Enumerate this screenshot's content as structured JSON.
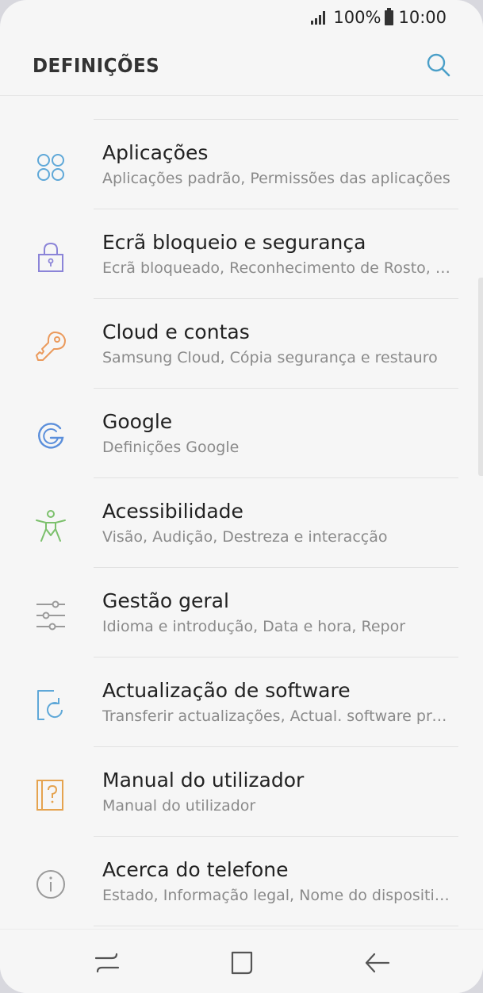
{
  "status_bar": {
    "battery": "100%",
    "time": "10:00"
  },
  "header": {
    "title": "DEFINIÇÕES",
    "search_icon": "search-icon"
  },
  "settings": [
    {
      "id": "apps",
      "title": "Aplicações",
      "subtitle": "Aplicações padrão, Permissões das aplicações",
      "icon": "apps-grid-icon",
      "color": "#5fa8d8"
    },
    {
      "id": "lock",
      "title": "Ecrã bloqueio e segurança",
      "subtitle": "Ecrã bloqueado, Reconhecimento de Rosto, Impressões digitais",
      "icon": "padlock-icon",
      "color": "#8b84d8"
    },
    {
      "id": "cloud",
      "title": "Cloud e contas",
      "subtitle": "Samsung Cloud, Cópia segurança e restauro",
      "icon": "key-icon",
      "color": "#eb9a5c"
    },
    {
      "id": "google",
      "title": "Google",
      "subtitle": "Definições Google",
      "icon": "google-g-icon",
      "color": "#5b8fdb"
    },
    {
      "id": "accessibility",
      "title": "Acessibilidade",
      "subtitle": "Visão, Audição, Destreza e interacção",
      "icon": "accessibility-person-icon",
      "color": "#7cc06c"
    },
    {
      "id": "general",
      "title": "Gestão geral",
      "subtitle": "Idioma e introdução, Data e hora, Repor",
      "icon": "sliders-icon",
      "color": "#9a9a9a"
    },
    {
      "id": "update",
      "title": "Actualização de software",
      "subtitle": "Transferir actualizações, Actual. software programadas",
      "icon": "software-update-icon",
      "color": "#5fa8d8"
    },
    {
      "id": "manual",
      "title": "Manual do utilizador",
      "subtitle": "Manual do utilizador",
      "icon": "user-manual-icon",
      "color": "#e5a34f"
    },
    {
      "id": "about",
      "title": "Acerca do telefone",
      "subtitle": "Estado, Informação legal, Nome do dispositivo",
      "icon": "info-icon",
      "color": "#9a9a9a"
    }
  ],
  "nav": {
    "recents": "recent-apps-icon",
    "home": "home-icon",
    "back": "back-arrow-icon"
  }
}
